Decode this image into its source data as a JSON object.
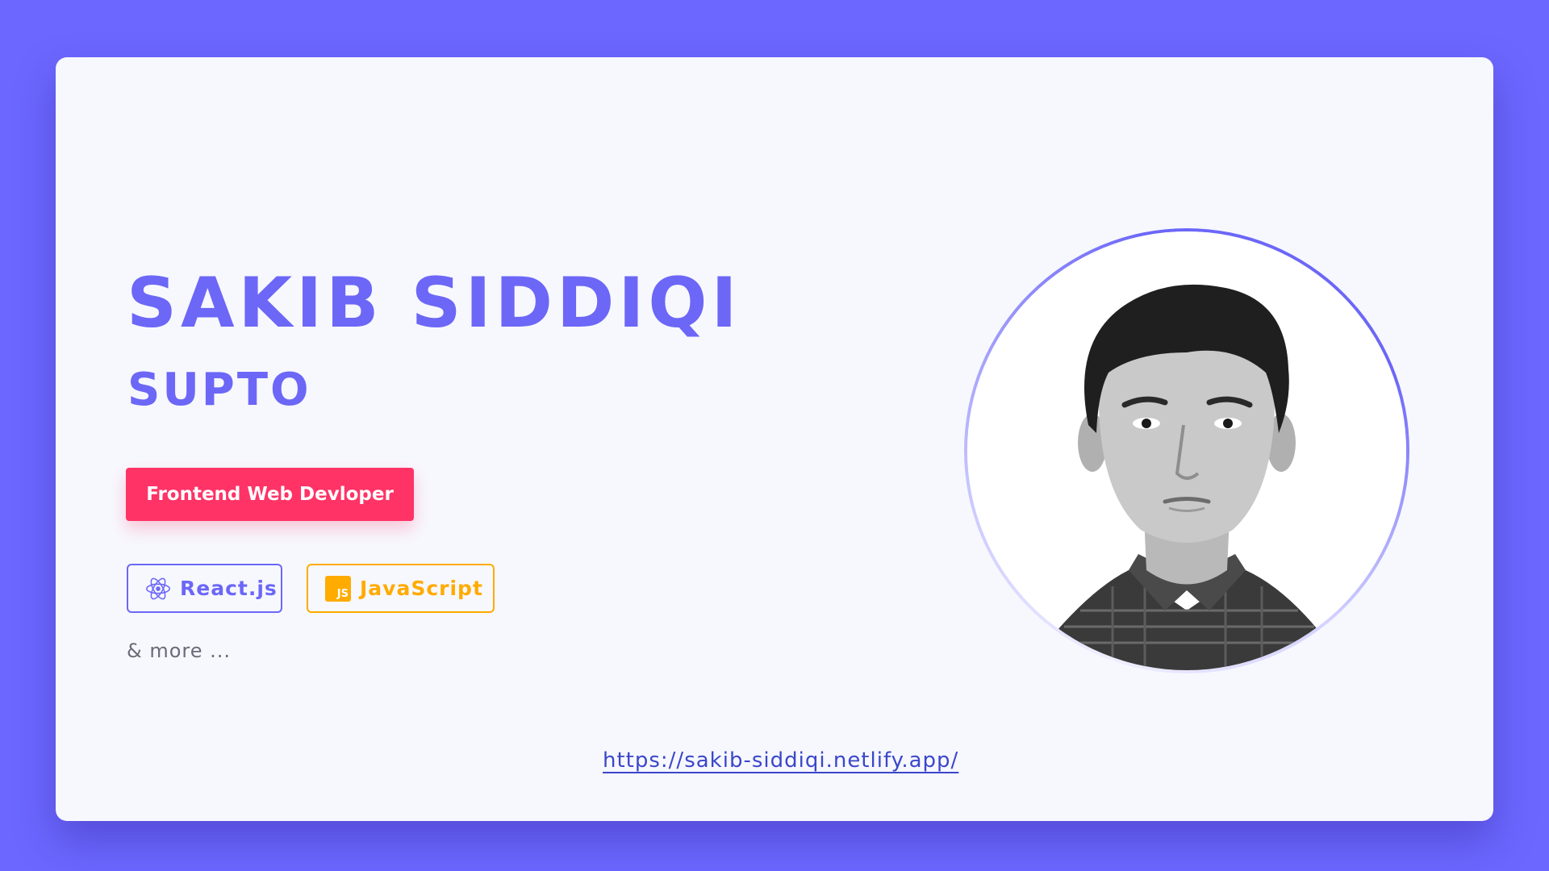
{
  "profile": {
    "name": "SAKIB SIDDIQI",
    "nickname": "SUPTO",
    "role": "Frontend Web Devloper",
    "more": "& more ...",
    "url": "https://sakib-siddiqi.netlify.app/"
  },
  "skills": [
    {
      "label": "React.js",
      "icon": "react-icon",
      "color": "#6c67f7"
    },
    {
      "label": "JavaScript",
      "icon": "javascript-icon",
      "icon_text": "JS",
      "color": "#ffab00"
    }
  ],
  "colors": {
    "background": "#6c67ff",
    "card": "#f7f8fe",
    "accent": "#6c67f7",
    "role_button": "#ff3366",
    "link": "#3b47c9"
  }
}
